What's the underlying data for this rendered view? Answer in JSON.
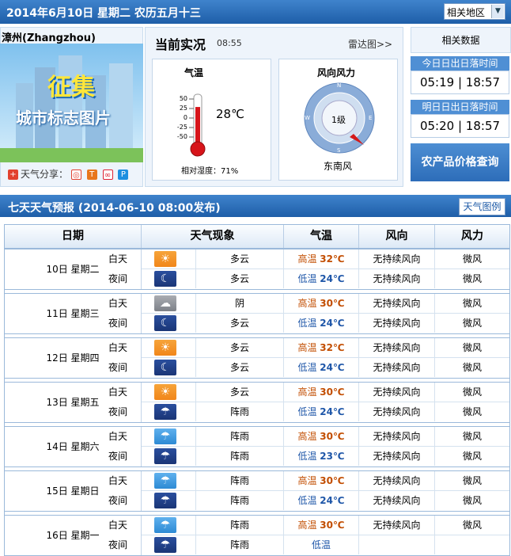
{
  "topbar": {
    "date_text": "2014年6月10日  星期二   农历五月十三",
    "region_label": "相关地区"
  },
  "city": {
    "name": "漳州(Zhangzhou)"
  },
  "banner": {
    "title": "征集",
    "subtitle": "城市标志图片"
  },
  "share": {
    "label": "天气分享："
  },
  "current": {
    "title": "当前实况",
    "time": "08:55",
    "radar": "雷达图>>",
    "temp_title": "气温",
    "temp_value": "28℃",
    "temp_fraction": 0.78,
    "scale": [
      "50",
      "25",
      "0",
      "-25",
      "-50"
    ],
    "humidity": "相对湿度：71%",
    "wind_title": "风向风力",
    "wind_level": "1级",
    "wind_dir": "东南风",
    "compass": {
      "n": "N",
      "e": "E",
      "s": "S",
      "w": "W"
    }
  },
  "related": {
    "title": "相关数据",
    "today_label": "今日日出日落时间",
    "today_sunrise": "05:19",
    "today_sunset": "18:57",
    "tomorrow_label": "明日日出日落时间",
    "tomorrow_sunrise": "05:20",
    "tomorrow_sunset": "18:57",
    "price_button": "农产品价格查询"
  },
  "forecast": {
    "title": "七天天气预报  (2014-06-10 08:00发布)",
    "legend_button": "天气图例",
    "headers": [
      "日期",
      "天气现象",
      "气温",
      "风向",
      "风力"
    ],
    "days": [
      {
        "date": "10日 星期二",
        "day": {
          "period": "白天",
          "icon": "partly-cloudy-day-icon",
          "weather": "多云",
          "tlabel": "高温",
          "temp": "32℃",
          "wind_dir": "无持续风向",
          "wind_force": "微风"
        },
        "night": {
          "period": "夜间",
          "icon": "partly-cloudy-night-icon",
          "weather": "多云",
          "tlabel": "低温",
          "temp": "24℃",
          "wind_dir": "无持续风向",
          "wind_force": "微风"
        }
      },
      {
        "date": "11日 星期三",
        "day": {
          "period": "白天",
          "icon": "overcast-icon",
          "weather": "阴",
          "tlabel": "高温",
          "temp": "30℃",
          "wind_dir": "无持续风向",
          "wind_force": "微风"
        },
        "night": {
          "period": "夜间",
          "icon": "partly-cloudy-night-icon",
          "weather": "多云",
          "tlabel": "低温",
          "temp": "24℃",
          "wind_dir": "无持续风向",
          "wind_force": "微风"
        }
      },
      {
        "date": "12日 星期四",
        "day": {
          "period": "白天",
          "icon": "partly-cloudy-day-icon",
          "weather": "多云",
          "tlabel": "高温",
          "temp": "32℃",
          "wind_dir": "无持续风向",
          "wind_force": "微风"
        },
        "night": {
          "period": "夜间",
          "icon": "partly-cloudy-night-icon",
          "weather": "多云",
          "tlabel": "低温",
          "temp": "24℃",
          "wind_dir": "无持续风向",
          "wind_force": "微风"
        }
      },
      {
        "date": "13日 星期五",
        "day": {
          "period": "白天",
          "icon": "partly-cloudy-day-icon",
          "weather": "多云",
          "tlabel": "高温",
          "temp": "30℃",
          "wind_dir": "无持续风向",
          "wind_force": "微风"
        },
        "night": {
          "period": "夜间",
          "icon": "shower-night-icon",
          "weather": "阵雨",
          "tlabel": "低温",
          "temp": "24℃",
          "wind_dir": "无持续风向",
          "wind_force": "微风"
        }
      },
      {
        "date": "14日 星期六",
        "day": {
          "period": "白天",
          "icon": "shower-day-icon",
          "weather": "阵雨",
          "tlabel": "高温",
          "temp": "30℃",
          "wind_dir": "无持续风向",
          "wind_force": "微风"
        },
        "night": {
          "period": "夜间",
          "icon": "shower-night-icon",
          "weather": "阵雨",
          "tlabel": "低温",
          "temp": "23℃",
          "wind_dir": "无持续风向",
          "wind_force": "微风"
        }
      },
      {
        "date": "15日 星期日",
        "day": {
          "period": "白天",
          "icon": "shower-day-icon",
          "weather": "阵雨",
          "tlabel": "高温",
          "temp": "30℃",
          "wind_dir": "无持续风向",
          "wind_force": "微风"
        },
        "night": {
          "period": "夜间",
          "icon": "shower-night-icon",
          "weather": "阵雨",
          "tlabel": "低温",
          "temp": "24℃",
          "wind_dir": "无持续风向",
          "wind_force": "微风"
        }
      },
      {
        "date": "16日 星期一",
        "day": {
          "period": "白天",
          "icon": "shower-day-icon",
          "weather": "阵雨",
          "tlabel": "高温",
          "temp": "30℃",
          "wind_dir": "无持续风向",
          "wind_force": "微风"
        },
        "night": {
          "period": "夜间",
          "icon": "shower-night-icon",
          "weather": "阵雨",
          "tlabel": "低温",
          "temp": "",
          "wind_dir": "",
          "wind_force": ""
        }
      }
    ]
  }
}
